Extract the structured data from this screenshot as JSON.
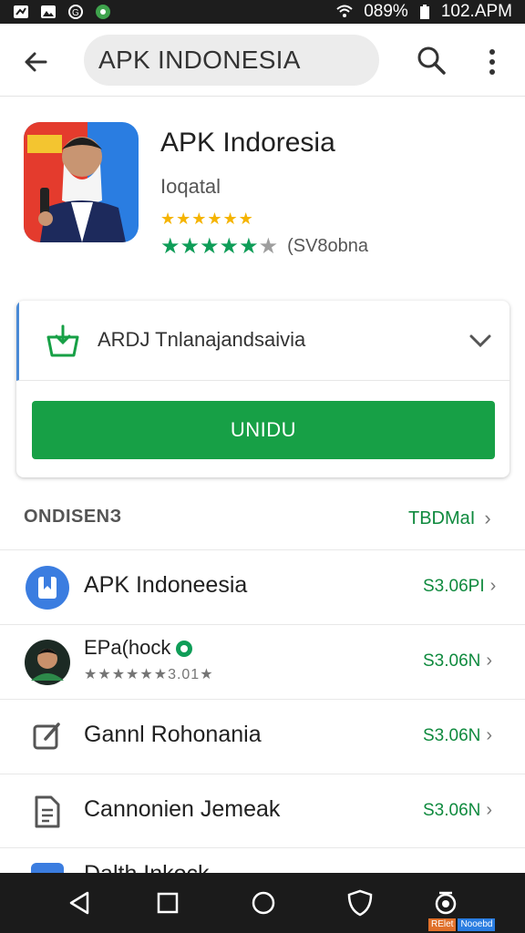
{
  "status_bar": {
    "battery": "089%",
    "time": "102.APM"
  },
  "app_bar": {
    "search_text": "APK INDONESIA"
  },
  "app": {
    "title": "APK Indoresia",
    "developer": "Ioqatal",
    "rating_small": "★★★★★★",
    "rating_count": "(SV8obna"
  },
  "install_card": {
    "row_label": "ARDJ Tnlanajandsaivia",
    "button_label": "UNIDU"
  },
  "section": {
    "title": "ONDISENЗ",
    "more_label": "TBDMaI",
    "chevron": "›"
  },
  "list": [
    {
      "label": "APK Indoneesia",
      "price": "S3.06PI",
      "icon": "bookmark-app-icon"
    },
    {
      "label": "EPa(hock",
      "sub": "★★★★★★3.01★",
      "price": "S3.06N",
      "icon": "avatar"
    },
    {
      "label": "Gannl Rohonania",
      "price": "S3.06N",
      "icon": "edit-icon"
    },
    {
      "label": "Cannonien Jemeak",
      "price": "S3.06N",
      "icon": "document-icon"
    }
  ],
  "partial_item": {
    "label": "Dalth Inkock"
  },
  "nav_badge": {
    "left": "RElet",
    "right": "Nooebd"
  },
  "colors": {
    "accent_green": "#17a046",
    "star_yellow": "#f5b400",
    "price_green": "#0f8a3e"
  }
}
